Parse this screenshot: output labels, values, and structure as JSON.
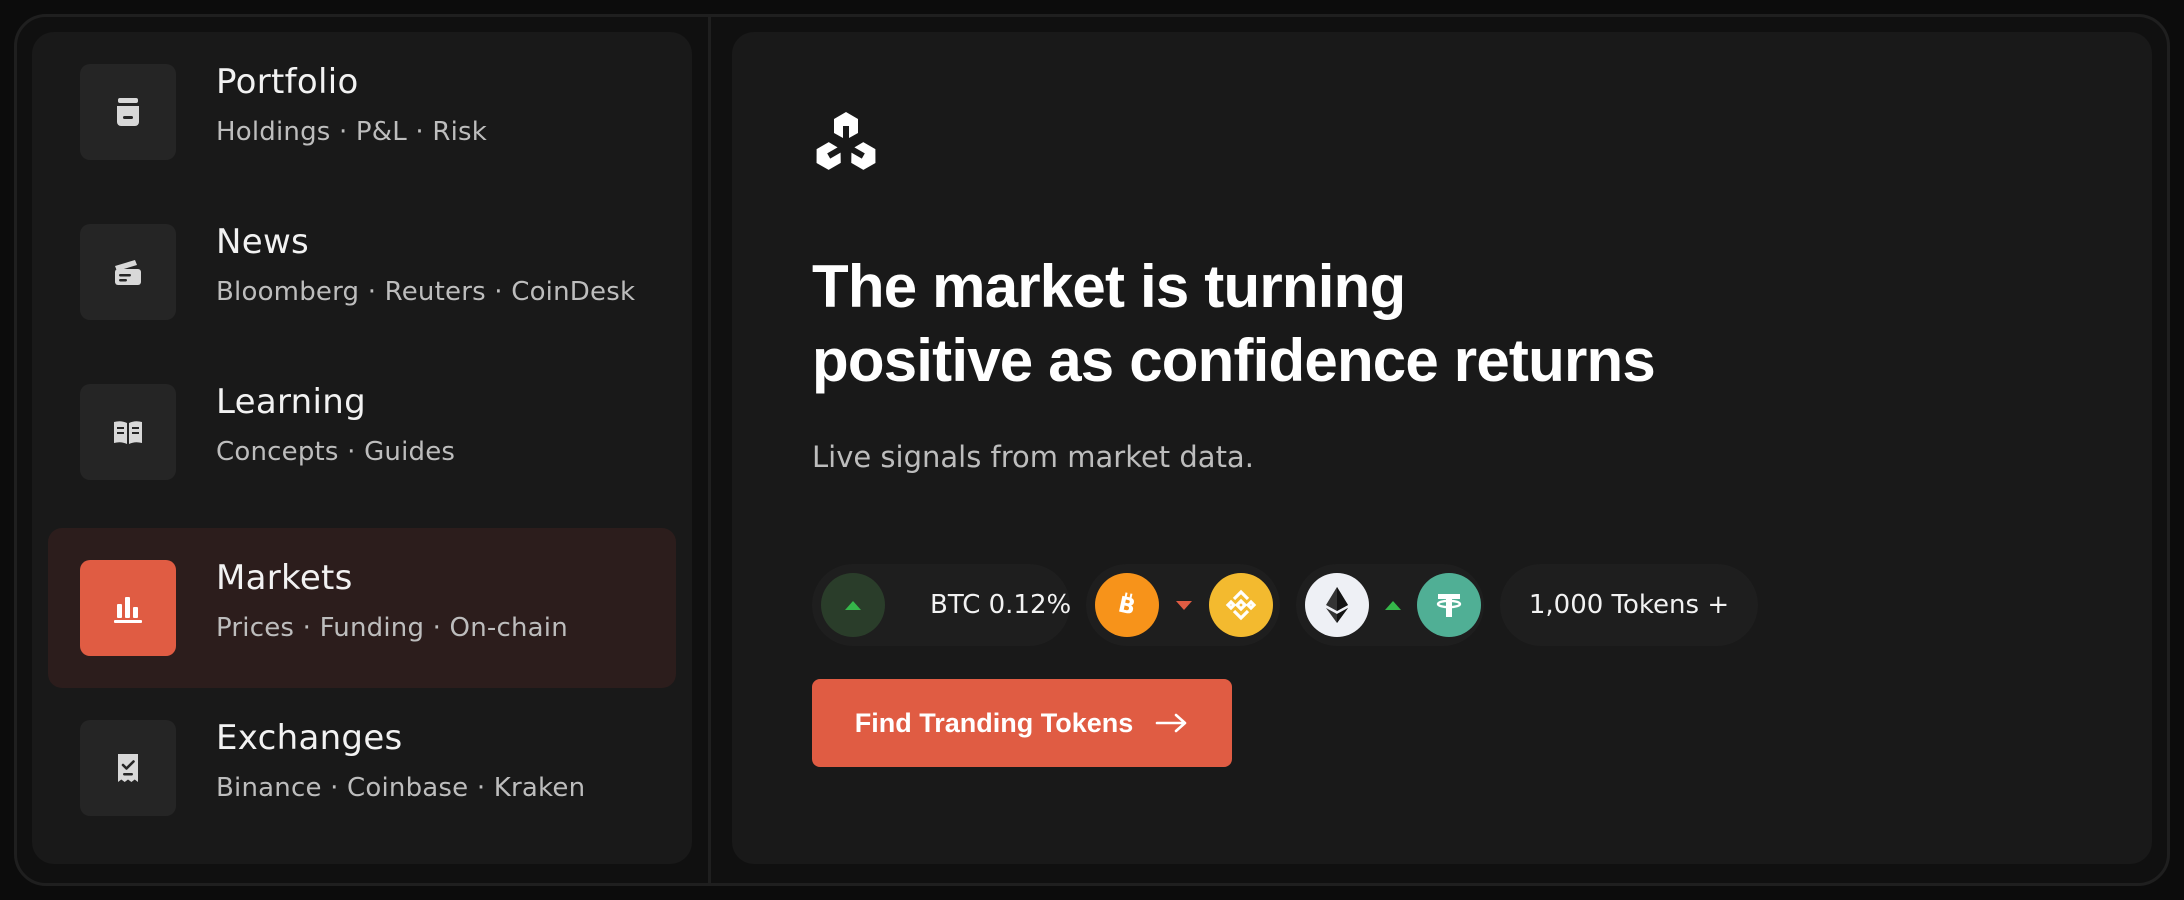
{
  "sidebar": {
    "items": [
      {
        "title": "Portfolio",
        "subtitle": "Holdings · P&L · Risk",
        "icon": "portfolio-jar-icon",
        "active": false
      },
      {
        "title": "News",
        "subtitle": "Bloomberg · Reuters · CoinDesk",
        "icon": "news-icon",
        "active": false
      },
      {
        "title": "Learning",
        "subtitle": "Concepts · Guides",
        "icon": "open-book-icon",
        "active": false
      },
      {
        "title": "Markets",
        "subtitle": "Prices · Funding · On-chain",
        "icon": "bar-chart-icon",
        "active": true
      },
      {
        "title": "Exchanges",
        "subtitle": "Binance · Coinbase · Kraken",
        "icon": "receipt-check-icon",
        "active": false
      }
    ]
  },
  "hero": {
    "logo_icon": "trefoil-logo-icon",
    "headline_line1": "The market is turning",
    "headline_line2": "positive as confidence returns",
    "subline": "Live signals from market data."
  },
  "tickers": {
    "btc_change": {
      "label": "BTC 0.12%",
      "direction": "up"
    },
    "pair1": {
      "left": "bitcoin-icon",
      "direction": "down",
      "right": "binance-coin-icon"
    },
    "pair2": {
      "left": "ethereum-icon",
      "direction": "up",
      "right": "tether-icon"
    },
    "tokens": {
      "label": "1,000 Tokens +"
    }
  },
  "cta": {
    "label": "Find Tranding Tokens",
    "icon": "arrow-right-icon"
  },
  "colors": {
    "accent": "#e05c43",
    "positive": "#35b64a",
    "bitcoin": "#f7931a",
    "binance": "#f3ba2f",
    "tether": "#50af95"
  }
}
